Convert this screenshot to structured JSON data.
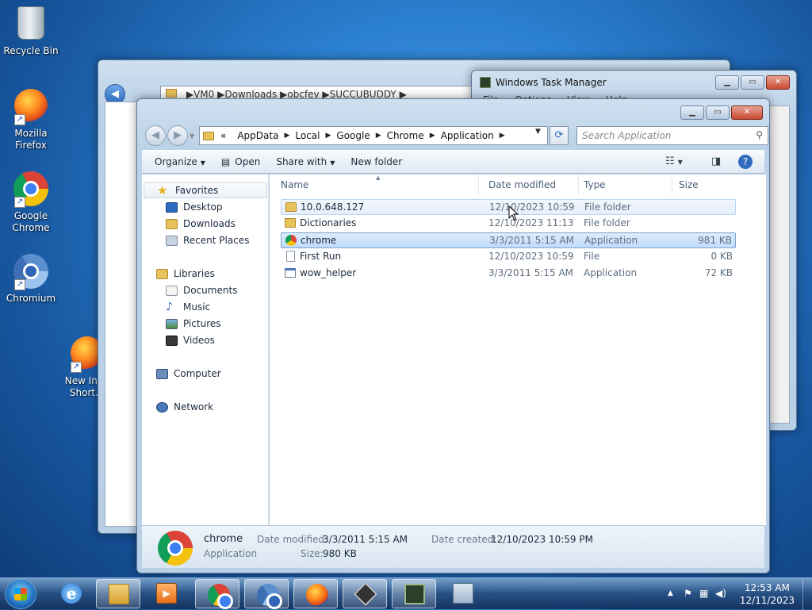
{
  "desktop": {
    "icons": [
      {
        "label": "Recycle Bin"
      },
      {
        "label": "Mozilla Firefox"
      },
      {
        "label": "Google Chrome"
      },
      {
        "label": "Chromium"
      },
      {
        "label": "New Inl… Short…"
      }
    ]
  },
  "background_explorer": {
    "breadcrumb": [
      "VM0",
      "Downloads",
      "obcfev",
      "SUCCUBUDDY"
    ]
  },
  "task_manager": {
    "title": "Windows Task Manager",
    "menu": [
      "File",
      "Options",
      "View",
      "Help"
    ]
  },
  "explorer": {
    "breadcrumb": {
      "prefix": "«",
      "items": [
        "AppData",
        "Local",
        "Google",
        "Chrome",
        "Application"
      ]
    },
    "search_placeholder": "Search Application",
    "toolbar": {
      "organize": "Organize",
      "open": "Open",
      "share_with": "Share with",
      "new_folder": "New folder"
    },
    "nav": {
      "favorites": "Favorites",
      "desktop": "Desktop",
      "downloads": "Downloads",
      "recent_places": "Recent Places",
      "libraries": "Libraries",
      "documents": "Documents",
      "music": "Music",
      "pictures": "Pictures",
      "videos": "Videos",
      "computer": "Computer",
      "network": "Network"
    },
    "columns": {
      "name": "Name",
      "date": "Date modified",
      "type": "Type",
      "size": "Size"
    },
    "files": [
      {
        "name": "10.0.648.127",
        "date": "12/10/2023 10:59 ...",
        "type": "File folder",
        "size": ""
      },
      {
        "name": "Dictionaries",
        "date": "12/10/2023 11:13 ...",
        "type": "File folder",
        "size": ""
      },
      {
        "name": "chrome",
        "date": "3/3/2011 5:15 AM",
        "type": "Application",
        "size": "981 KB"
      },
      {
        "name": "First Run",
        "date": "12/10/2023 10:59 ...",
        "type": "File",
        "size": "0 KB"
      },
      {
        "name": "wow_helper",
        "date": "3/3/2011 5:15 AM",
        "type": "Application",
        "size": "72 KB"
      }
    ],
    "details": {
      "name": "chrome",
      "kind": "Application",
      "date_modified_label": "Date modified:",
      "date_modified": "3/3/2011 5:15 AM",
      "size_label": "Size:",
      "size": "980 KB",
      "date_created_label": "Date created:",
      "date_created": "12/10/2023 10:59 PM"
    }
  },
  "taskbar": {
    "time": "12:53 AM",
    "date": "12/11/2023"
  },
  "icons": {
    "back": "back-arrow-icon",
    "forward": "forward-arrow-icon",
    "refresh": "refresh-icon",
    "search": "search-icon",
    "help": "help-icon"
  },
  "colors": {
    "selection": "#c1dcfb",
    "hover": "#e5eefa",
    "desktop": "#2b7fcf"
  }
}
